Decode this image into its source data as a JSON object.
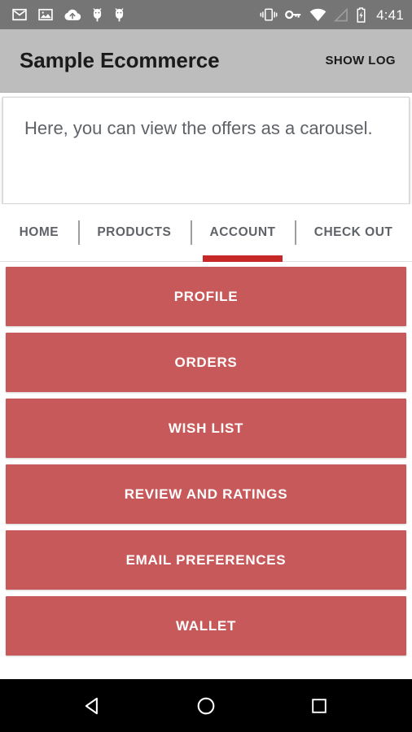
{
  "status_bar": {
    "time": "4:41",
    "left_icons": [
      {
        "name": "gmail-icon",
        "label": "Gmail"
      },
      {
        "name": "image-icon",
        "label": "Screenshot"
      },
      {
        "name": "cloud-upload-icon",
        "label": "Cloud upload"
      },
      {
        "name": "android-debug-icon",
        "label": "USB debugging"
      },
      {
        "name": "android-debug-icon-2",
        "label": "USB debugging"
      }
    ],
    "right_icons": [
      {
        "name": "vibrate-icon",
        "label": "Vibrate"
      },
      {
        "name": "vpn-key-icon",
        "label": "VPN"
      },
      {
        "name": "wifi-icon",
        "label": "Wi-Fi"
      },
      {
        "name": "cell-signal-icon",
        "label": "No signal"
      },
      {
        "name": "battery-charging-icon",
        "label": "Battery charging"
      }
    ],
    "background_color": "#757575"
  },
  "app_bar": {
    "title": "Sample Ecommerce",
    "action_label": "SHOW LOG",
    "background_color": "#bdbdbd"
  },
  "info_card": {
    "text": "Here, you can view the offers as a carousel.",
    "text_color": "#5f6368"
  },
  "tabs": {
    "active_index": 2,
    "indicator_color": "#c62828",
    "items": [
      {
        "label": "HOME",
        "name": "tab-home"
      },
      {
        "label": "PRODUCTS",
        "name": "tab-products"
      },
      {
        "label": "ACCOUNT",
        "name": "tab-account"
      },
      {
        "label": "CHECK OUT",
        "name": "tab-check-out"
      }
    ]
  },
  "account_menu": {
    "button_color": "#c8595a",
    "buttons": [
      {
        "label": "PROFILE",
        "name": "profile-button"
      },
      {
        "label": "ORDERS",
        "name": "orders-button"
      },
      {
        "label": "WISH LIST",
        "name": "wish-list-button"
      },
      {
        "label": "REVIEW AND RATINGS",
        "name": "review-and-ratings-button"
      },
      {
        "label": "EMAIL PREFERENCES",
        "name": "email-preferences-button"
      },
      {
        "label": "WALLET",
        "name": "wallet-button"
      }
    ]
  },
  "nav_bar": {
    "background_color": "#000000",
    "buttons": [
      {
        "name": "nav-back-button",
        "label": "Back"
      },
      {
        "name": "nav-home-button",
        "label": "Home"
      },
      {
        "name": "nav-recents-button",
        "label": "Recents"
      }
    ]
  }
}
